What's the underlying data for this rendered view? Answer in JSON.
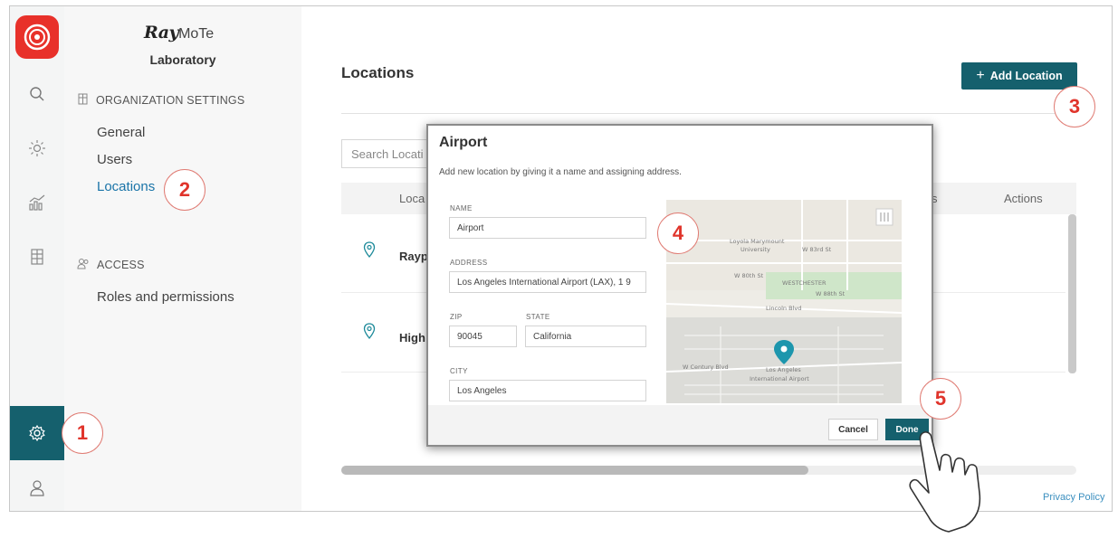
{
  "app": {
    "brand_main": "Ray",
    "brand_tail": "MoTe",
    "organization": "Laboratory"
  },
  "rail": {
    "icons": [
      "app-logo-icon",
      "search-icon",
      "sun-icon",
      "analytics-icon",
      "building-icon",
      "settings-icon",
      "user-icon"
    ],
    "active": "settings-icon",
    "accent": "#15606d",
    "logo_color": "#e8312a"
  },
  "sidebar": {
    "org_settings_heading": "ORGANIZATION SETTINGS",
    "org_items": [
      {
        "label": "General"
      },
      {
        "label": "Users"
      },
      {
        "label": "Locations",
        "active": true
      }
    ],
    "access_heading": "ACCESS",
    "access_items": [
      {
        "label": "Roles and permissions"
      }
    ]
  },
  "main": {
    "title": "Locations",
    "add_button": "Add Location",
    "search_placeholder": "Search Locati",
    "columns": {
      "location": "Loca",
      "users": "s",
      "actions": "Actions"
    },
    "rows": [
      {
        "name": "Rayp"
      },
      {
        "name": "High"
      }
    ],
    "privacy_link": "Privacy Policy"
  },
  "modal": {
    "title": "Airport",
    "subtitle": "Add new location by giving it a name and assigning address.",
    "name_label": "NAME",
    "name_value": "Airport",
    "address_label": "ADDRESS",
    "address_value": "Los Angeles International Airport (LAX), 1 9",
    "zip_label": "ZIP",
    "zip_value": "90045",
    "state_label": "STATE",
    "state_value": "California",
    "city_label": "CITY",
    "city_value": "Los Angeles",
    "map_labels": {
      "university": "Loyola Marymount",
      "university2": "University",
      "street1": "W 83rd St",
      "street2": "W 80th St",
      "street3": "W 88th St",
      "district": "WESTCHESTER",
      "blvd": "Lincoln Blvd",
      "century": "W Century Blvd",
      "airport": "Los Angeles",
      "airport2": "International Airport"
    },
    "cancel": "Cancel",
    "done": "Done"
  },
  "callouts": [
    "1",
    "2",
    "3",
    "4",
    "5"
  ]
}
